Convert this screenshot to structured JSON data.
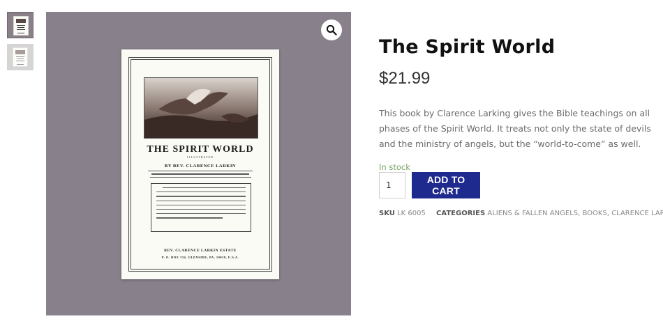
{
  "gallery": {
    "zoom_icon": "magnifier-icon",
    "cover": {
      "title": "THE SPIRIT WORLD",
      "illustrated": "ILLUSTRATED",
      "author": "BY REV. CLARENCE LARKIN",
      "publisher": "REV. CLARENCE LARKIN ESTATE",
      "address": "P. O. BOX 334, GLENSIDE, PA. 19038, U.S.A."
    }
  },
  "product": {
    "title": "The Spirit World",
    "price": "$21.99",
    "description": "This book by Clarence Larking gives the Bible teachings on all phases of the Spirit World. It treats not only the state of devils and the ministry of angels, but the “world-to-come” as well.",
    "stock_status": "In stock",
    "quantity": "1",
    "add_to_cart_label": "ADD TO CART",
    "sku_label": "SKU",
    "sku": "LK 6005",
    "categories_label": "CATEGORIES",
    "categories": [
      "ALIENS & FALLEN ANGELS",
      "BOOKS",
      "CLARENCE LARKIN"
    ]
  },
  "colors": {
    "accent_button": "#1f2a8f",
    "in_stock": "#77a464",
    "image_background": "#88808a"
  }
}
